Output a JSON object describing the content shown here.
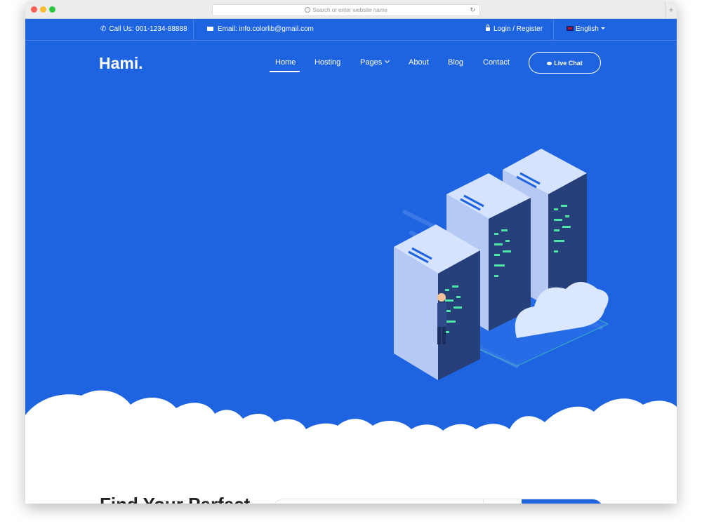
{
  "browser": {
    "url_placeholder": "Search or enter website name"
  },
  "topbar": {
    "phone": "Call Us: 001-1234-88888",
    "email": "Email: info.colorlib@gmail.com",
    "login": "Login / Register",
    "language": "English"
  },
  "header": {
    "logo": "Hami.",
    "nav": [
      "Home",
      "Hosting",
      "Pages",
      "About",
      "Blog",
      "Contact"
    ],
    "live_chat": "Live Chat"
  },
  "colors": {
    "primary": "#1e63e0",
    "white": "#ffffff"
  },
  "icons": [
    "phone-icon",
    "mail-icon",
    "lock-icon",
    "flag-icon",
    "chevron-down-icon",
    "chat-icon"
  ],
  "section": {
    "find_title": "Find Your Perfect"
  }
}
